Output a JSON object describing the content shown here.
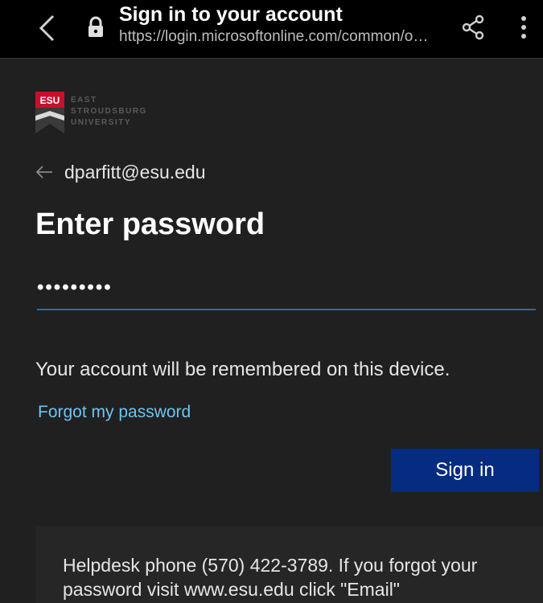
{
  "browser": {
    "title": "Sign in to your account",
    "url": "https://login.microsoftonline.com/common/o…",
    "icons": {
      "back": "chevron-left-icon",
      "lock": "lock-icon",
      "share": "share-icon",
      "menu": "more-vertical-icon"
    }
  },
  "logo": {
    "mark_text": "ESU",
    "lines": [
      "EAST",
      "STROUDSBURG",
      "UNIVERSITY"
    ],
    "colors": {
      "red": "#c8102e",
      "text": "#5a5a5a"
    }
  },
  "identity": {
    "email": "dparfitt@esu.edu"
  },
  "heading": "Enter password",
  "password": {
    "value": "•••••••••"
  },
  "remember_text": "Your account will be remembered on this device.",
  "forgot_link": "Forgot my password",
  "sign_in_label": "Sign in",
  "help_text": "Helpdesk phone (570) 422-3789. If you forgot your password visit www.esu.edu click \"Email\"",
  "colors": {
    "background": "#202020",
    "accent_button": "#052c80",
    "link": "#6cc4f4",
    "input_underline": "#1f6fb8"
  }
}
